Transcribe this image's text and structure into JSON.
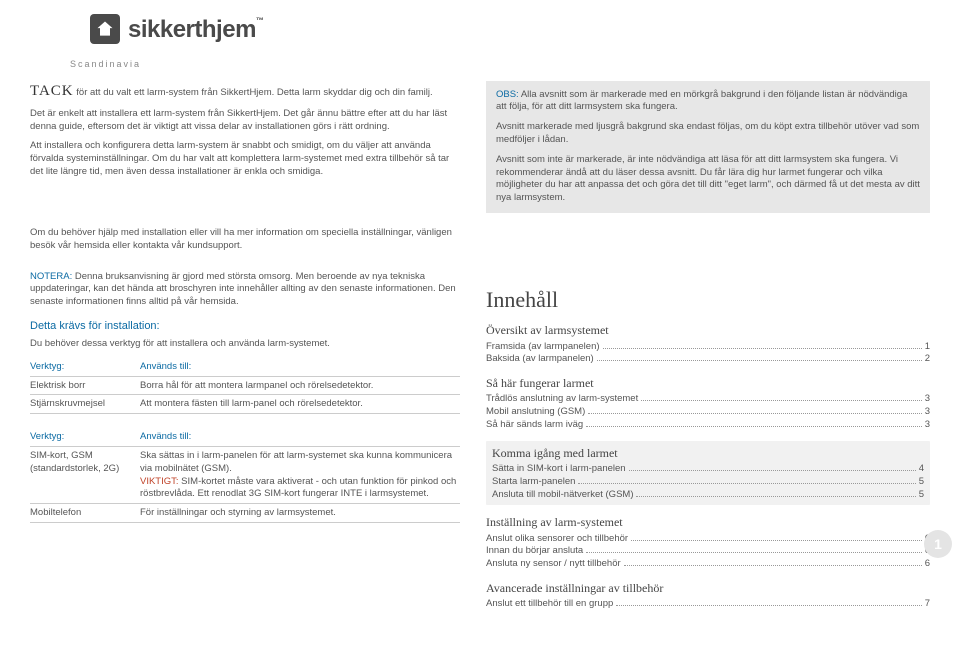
{
  "brand": {
    "name": "sikkerthjem",
    "tm": "™",
    "sub": "Scandinavia"
  },
  "intro": {
    "tack": "TACK",
    "tack_rest": " för att du valt ett larm-system från SikkertHjem. Detta larm skyddar dig och din familj.",
    "p2": "Det är enkelt att installera ett larm-system från SikkertHjem. Det går ännu bättre efter att du har läst denna guide, eftersom det är viktigt att vissa delar av installationen görs i rätt ordning.",
    "p3": "Att installera och konfigurera detta larm-system är snabbt och smidigt, om du väljer att använda förvalda systeminställningar. Om du har valt att komplettera larm-systemet med extra tillbehör så tar det lite längre tid, men även dessa installationer är enkla och smidiga.",
    "p4": "Om du behöver hjälp med installation eller vill ha mer information om speciella inställningar, vänligen besök vår hemsida eller kontakta vår kundsupport."
  },
  "notera": {
    "lead": "NOTERA:",
    "text": "  Denna bruksanvisning är gjord med största omsorg. Men beroende av nya tekniska uppdateringar, kan det hända att broschyren inte innehåller allting av den senaste informationen. Den senaste informationen finns alltid på vår hemsida."
  },
  "req": {
    "title": "Detta krävs för installation:",
    "sub": "Du behöver dessa verktyg för att installera och använda larm-systemet.",
    "h_tool": "Verktyg:",
    "h_use": "Används till:",
    "t1": [
      {
        "c1": "Elektrisk borr",
        "c2": "Borra hål för att montera larmpanel och rörelsedetektor."
      },
      {
        "c1": "Stjärnskruvmejsel",
        "c2": "Att montera fästen till larm-panel och rörelsedetektor."
      }
    ],
    "t2": [
      {
        "c1": "SIM-kort, GSM (standardstorlek, 2G)",
        "c2a": "Ska sättas in i larm-panelen för att larm-systemet ska kunna kommunicera via mobilnätet (GSM).",
        "v": "VIKTIGT:",
        "c2b": "  SIM-kortet måste vara aktiverat - och utan funktion för pinkod och röstbrevlåda. Ett renodlat 3G SIM-kort fungerar INTE i larmsystemet."
      },
      {
        "c1": "Mobiltelefon",
        "c2a": "För inställningar och styrning av larmsystemet.",
        "v": "",
        "c2b": ""
      }
    ]
  },
  "obs": {
    "lead": "OBS:",
    "p1": "  Alla avsnitt som är markerade med en mörkgrå bakgrund i den följande listan är nödvändiga att följa, för att ditt larmsystem ska fungera.",
    "p2": "Avsnitt markerade med ljusgrå bakgrund ska endast följas, om du köpt extra tillbehör utöver vad som medföljer i lådan.",
    "p3": "Avsnitt som inte är markerade, är inte nödvändiga att läsa för att ditt larmsystem ska fungera. Vi rekommenderar ändå att du läser dessa avsnitt. Du får lära dig hur larmet fungerar och vilka möjligheter du har att anpassa det och göra det till ditt \"eget larm\", och därmed få ut det mesta av ditt nya larmsystem."
  },
  "toc": {
    "title": "Innehåll",
    "sections": [
      {
        "head": "Översikt av larmsystemet",
        "shade": false,
        "items": [
          {
            "label": "Framsida (av larmpanelen)",
            "page": "1"
          },
          {
            "label": "Baksida (av larmpanelen)",
            "page": "2"
          }
        ]
      },
      {
        "head": "Så här fungerar larmet",
        "shade": false,
        "items": [
          {
            "label": "Trådlös anslutning av larm-systemet",
            "page": "3"
          },
          {
            "label": "Mobil anslutning (GSM)",
            "page": "3"
          },
          {
            "label": "Så här sänds larm iväg",
            "page": "3"
          }
        ]
      },
      {
        "head": "Komma igång med larmet",
        "shade": true,
        "items": [
          {
            "label": "Sätta in SIM-kort i larm-panelen",
            "page": "4"
          },
          {
            "label": "Starta larm-panelen",
            "page": "5"
          },
          {
            "label": "Ansluta till mobil-nätverket (GSM)",
            "page": "5"
          }
        ]
      },
      {
        "head": "Inställning av larm-systemet",
        "shade": false,
        "items": [
          {
            "label": "Anslut olika sensorer och tillbehör",
            "page": "6"
          },
          {
            "label": "Innan du börjar ansluta",
            "page": "6"
          },
          {
            "label": "Ansluta ny sensor / nytt tillbehör",
            "page": "6"
          }
        ]
      },
      {
        "head": "Avancerade inställningar av tillbehör",
        "shade": false,
        "items": [
          {
            "label": "Anslut ett tillbehör till en grupp",
            "page": "7"
          }
        ]
      }
    ]
  },
  "pagenum": "1"
}
